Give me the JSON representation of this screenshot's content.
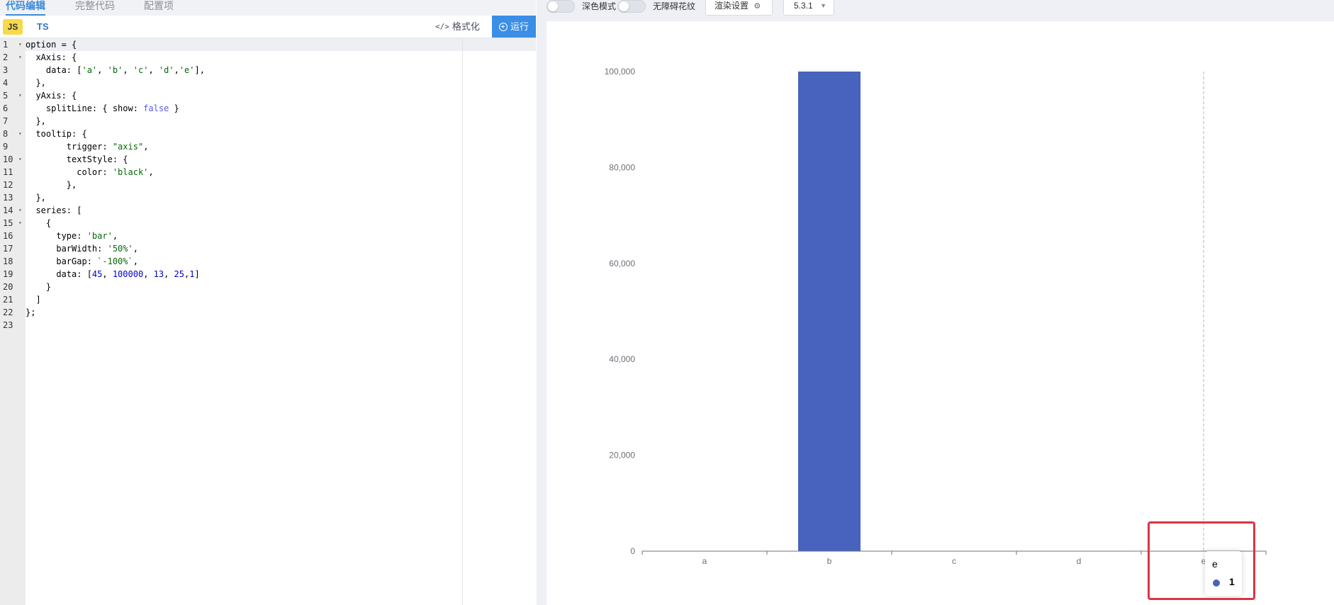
{
  "editor": {
    "tabs": [
      "代码编辑",
      "完整代码",
      "配置项"
    ],
    "lang_js": "JS",
    "lang_ts": "TS",
    "format_label": "格式化",
    "run_label": "运行",
    "lines": [
      "option = {",
      "  xAxis: {",
      "    data: ['a', 'b', 'c', 'd','e'],",
      "  },",
      "  yAxis: {",
      "    splitLine: { show: false }",
      "  },",
      "  tooltip: {",
      "        trigger: \"axis\",",
      "        textStyle: {",
      "          color: 'black',",
      "        },",
      "  },",
      "  series: [",
      "    {",
      "      type: 'bar',",
      "      barWidth: '50%',",
      "      barGap: `-100%`,",
      "      data: [45, 100000, 13, 25,1]",
      "    }",
      "  ]",
      "};",
      ""
    ],
    "foldable": [
      1,
      2,
      5,
      8,
      10,
      14,
      15
    ]
  },
  "preview": {
    "toggle_dark_label": "深色模式",
    "toggle_a11y_label": "无障碍花纹",
    "render_settings_label": "渲染设置",
    "version": "5.3.1"
  },
  "tooltip": {
    "name": "e",
    "value": "1",
    "marker_color": "#4763bd"
  },
  "colors": {
    "bar": "#4763bd",
    "highlight": "#d83545",
    "run": "#3a8ee6"
  },
  "chart_data": {
    "type": "bar",
    "categories": [
      "a",
      "b",
      "c",
      "d",
      "e"
    ],
    "values": [
      45,
      100000,
      13,
      25,
      1
    ],
    "ylim": [
      0,
      100000
    ],
    "yticks": [
      0,
      20000,
      40000,
      60000,
      80000,
      100000
    ],
    "ytick_labels": [
      "0",
      "20,000",
      "40,000",
      "60,000",
      "80,000",
      "100,000"
    ],
    "grid": false,
    "bar_width_fraction": 0.5,
    "axis_pointer_category": "e"
  }
}
